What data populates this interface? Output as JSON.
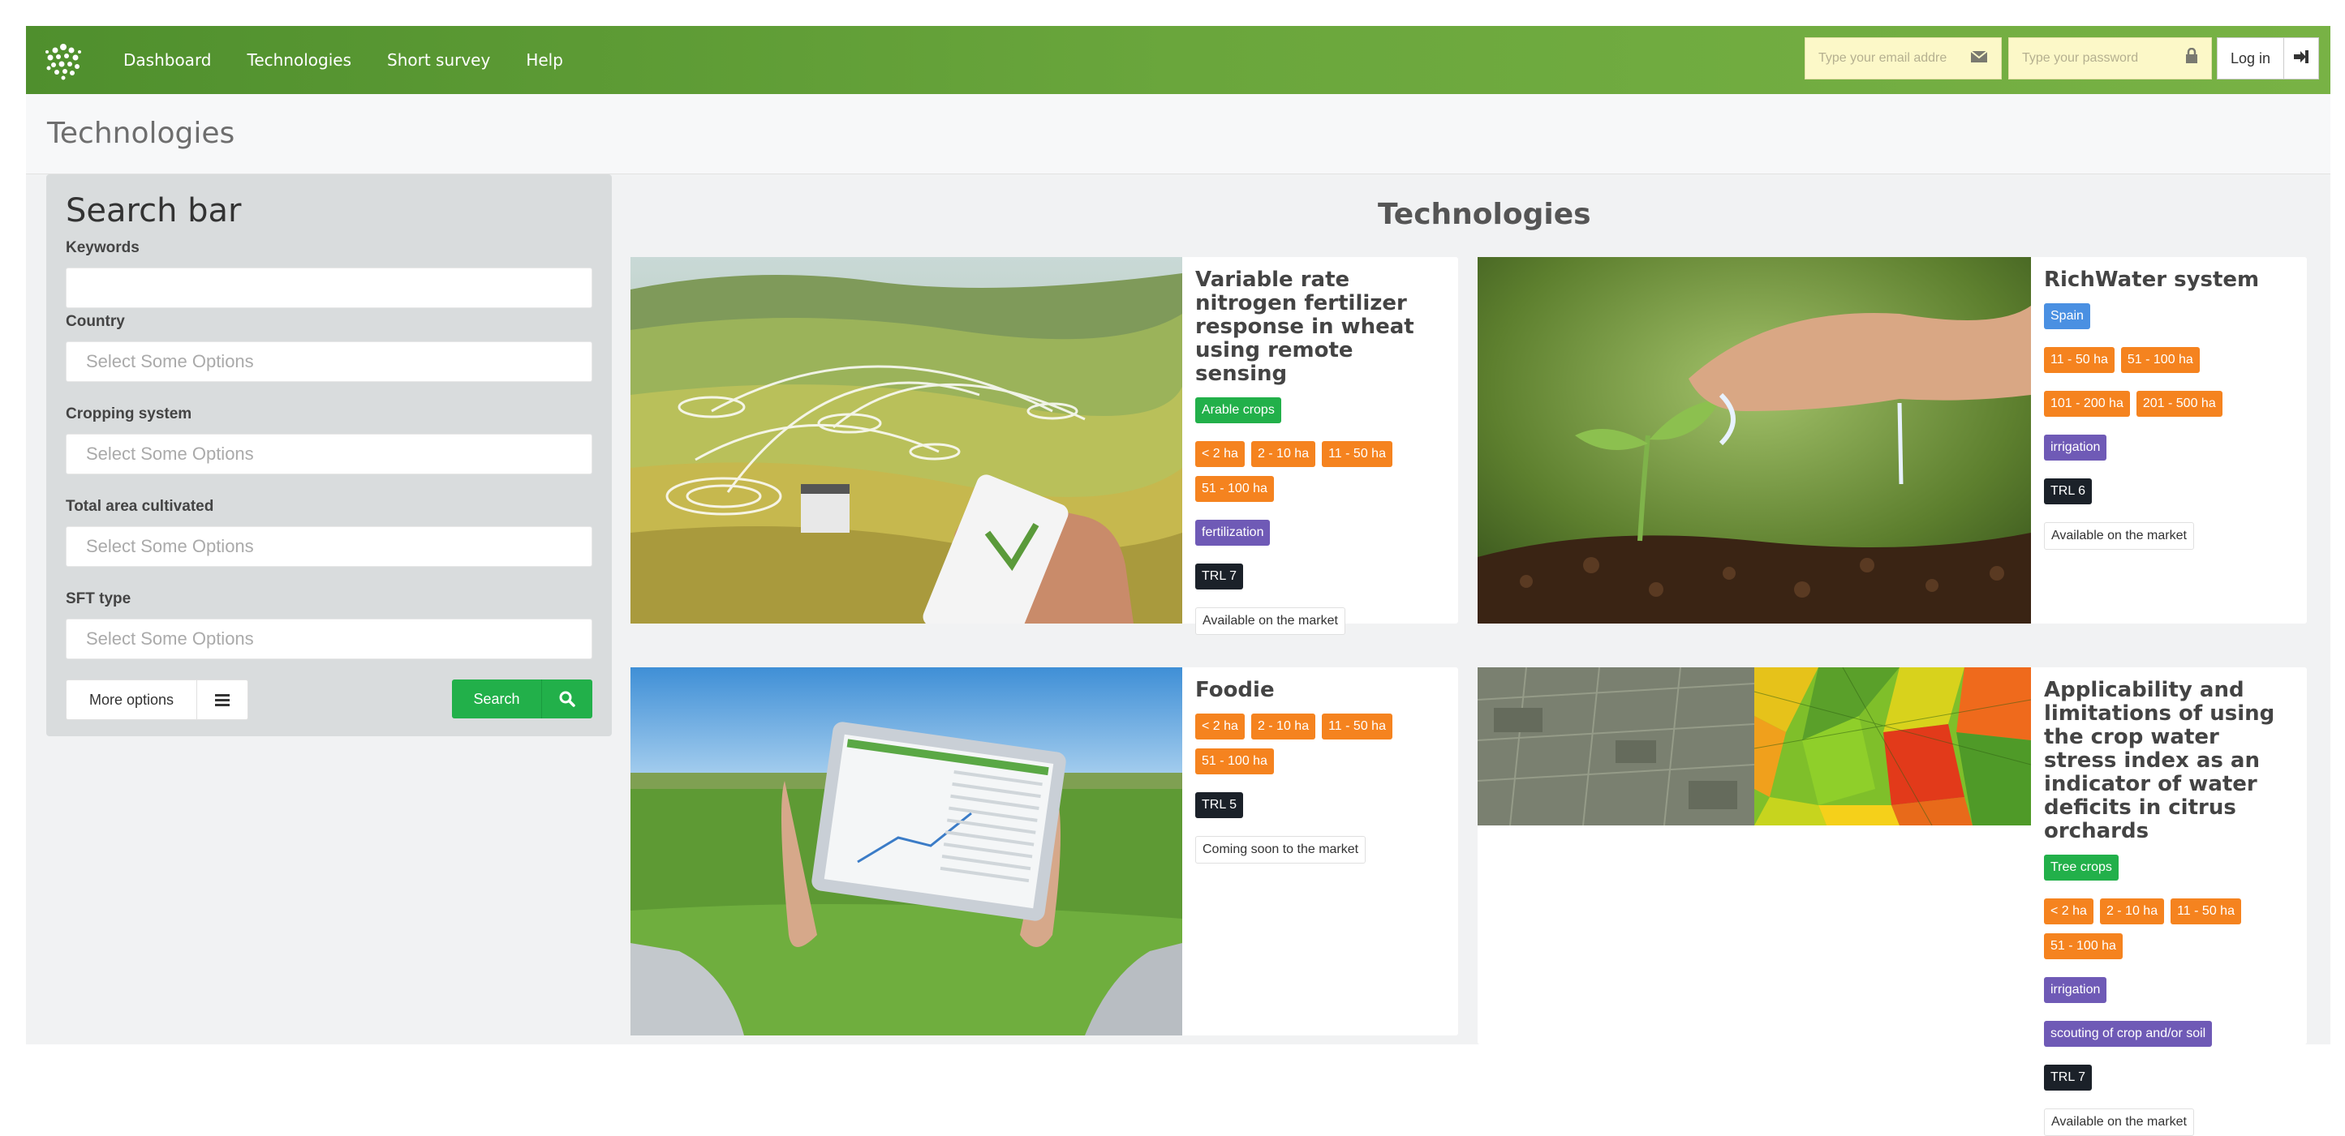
{
  "nav": {
    "links": [
      "Dashboard",
      "Technologies",
      "Short survey",
      "Help"
    ],
    "email_placeholder": "Type your email addre",
    "password_placeholder": "Type your password",
    "login_label": "Log in"
  },
  "page": {
    "title": "Technologies"
  },
  "sidebar": {
    "title": "Search bar",
    "keywords_label": "Keywords",
    "keywords_value": "",
    "country_label": "Country",
    "country_placeholder": "Select Some Options",
    "cropping_label": "Cropping system",
    "cropping_placeholder": "Select Some Options",
    "area_label": "Total area cultivated",
    "area_placeholder": "Select Some Options",
    "sft_label": "SFT type",
    "sft_placeholder": "Select Some Options",
    "more_options_label": "More options",
    "search_label": "Search"
  },
  "main": {
    "title": "Technologies",
    "cards": [
      {
        "title": "Variable rate nitrogen fertilizer response in wheat using remote sensing",
        "crop": "Arable crops",
        "areas": [
          "< 2 ha",
          "2 - 10 ha",
          "11 - 50 ha",
          "51 - 100 ha"
        ],
        "sft": [
          "fertilization"
        ],
        "trl": "TRL 7",
        "market": "Available on the market"
      },
      {
        "title": "RichWater system",
        "country": "Spain",
        "areas": [
          "11 - 50 ha",
          "51 - 100 ha",
          "101 - 200 ha",
          "201 - 500 ha"
        ],
        "sft": [
          "irrigation"
        ],
        "trl": "TRL 6",
        "market": "Available on the market"
      },
      {
        "title": "Foodie",
        "areas": [
          "< 2 ha",
          "2 - 10 ha",
          "11 - 50 ha",
          "51 - 100 ha"
        ],
        "trl": "TRL 5",
        "market": "Coming soon to the market"
      },
      {
        "title": "Applicability and limitations of using the crop water stress index as an indicator of water deficits in citrus orchards",
        "crop": "Tree crops",
        "areas": [
          "< 2 ha",
          "2 - 10 ha",
          "11 - 50 ha",
          "51 - 100 ha"
        ],
        "sft": [
          "irrigation",
          "scouting of crop and/or soil"
        ],
        "trl": "TRL 7",
        "market": "Available on the market"
      }
    ]
  },
  "colors": {
    "nav_green": "#6aa63c",
    "crop_tag": "#22b04a",
    "area_tag": "#f5831f",
    "sft_tag": "#6f5ab6",
    "trl_tag": "#1b2129",
    "country_tag": "#4a90e2"
  },
  "icons": [
    "logo-icon",
    "envelope-icon",
    "lock-icon",
    "sign-in-icon",
    "list-icon",
    "search-icon"
  ]
}
